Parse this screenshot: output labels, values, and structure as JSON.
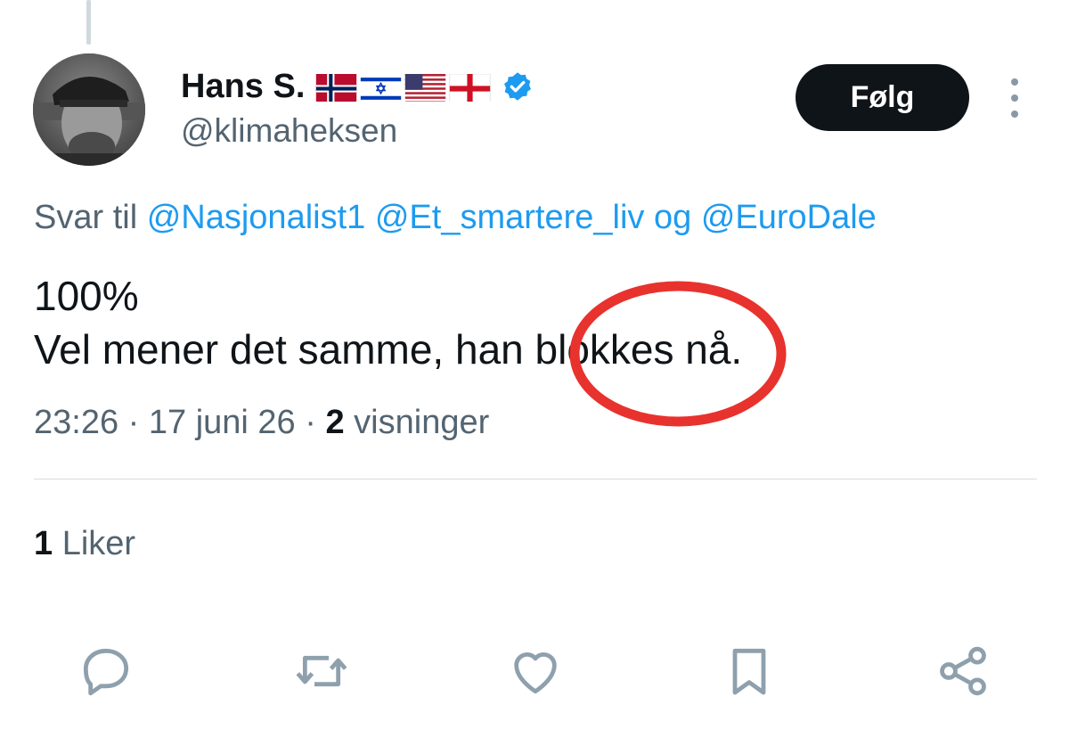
{
  "author": {
    "display_name": "Hans S.",
    "flags": [
      "norway-flag",
      "israel-flag",
      "usa-flag",
      "england-flag"
    ],
    "verified": true,
    "handle": "@klimaheksen"
  },
  "follow_label": "Følg",
  "reply_to": {
    "prefix": "Svar til",
    "mention_1": "@Nasjonalist1",
    "mention_2": "@Et_smartere_liv",
    "joiner": "og",
    "mention_3": "@EuroDale"
  },
  "tweet": {
    "line_1": "100%",
    "line_2": "Vel mener det samme, han blokkes nå."
  },
  "meta": {
    "time": "23:26",
    "sep_1": "·",
    "date": "17 juni 26",
    "sep_2": "·",
    "views_count": "2",
    "views_label": "visninger"
  },
  "likes": {
    "count": "1",
    "label": "Liker"
  },
  "actions": [
    "reply-icon",
    "retweet-icon",
    "like-icon",
    "bookmark-icon",
    "share-icon"
  ],
  "colors": {
    "accent": "#1d9bf0",
    "text": "#0f1419",
    "muted": "#536471",
    "annotation": "#e8322e",
    "icon": "#8fa0ad"
  }
}
